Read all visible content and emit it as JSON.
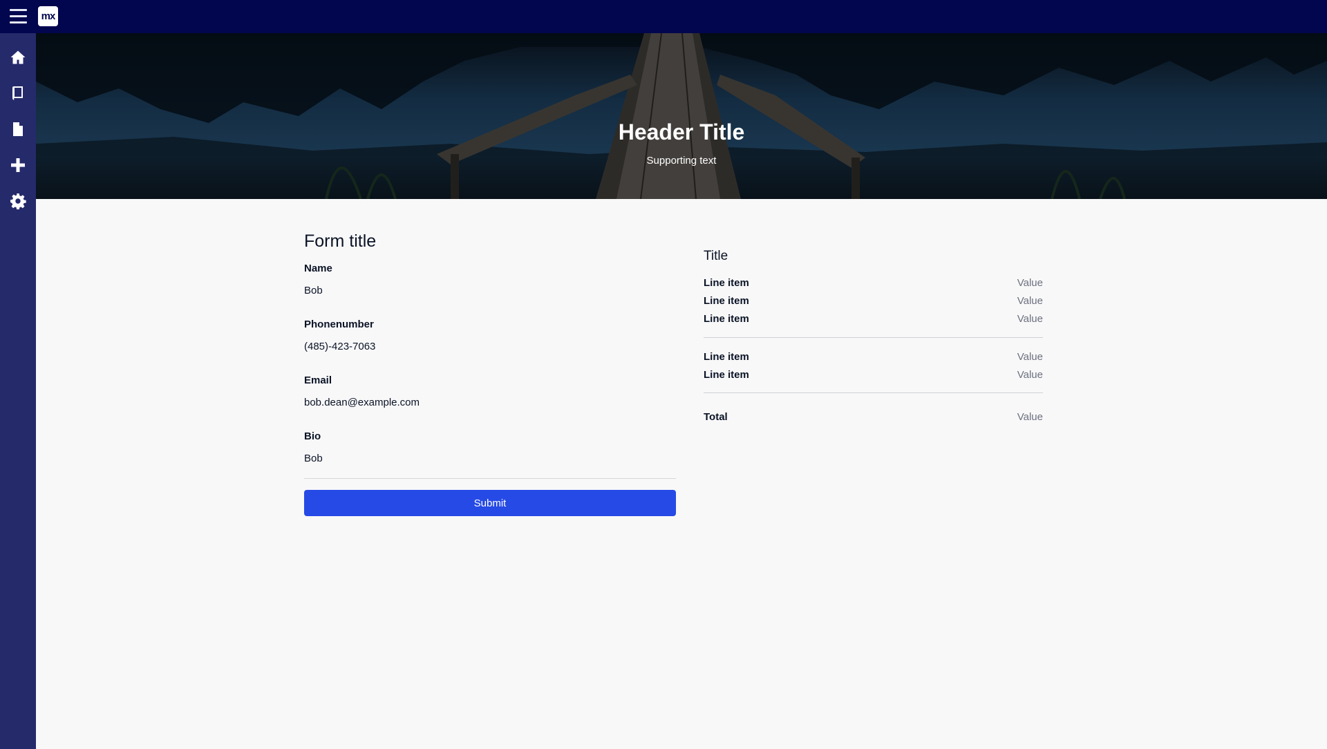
{
  "app": {
    "logo_text": "mx"
  },
  "sidebar": {
    "items": [
      {
        "icon": "home-icon"
      },
      {
        "icon": "book-icon"
      },
      {
        "icon": "document-icon"
      },
      {
        "icon": "plus-icon"
      },
      {
        "icon": "gear-icon"
      }
    ]
  },
  "hero": {
    "title": "Header Title",
    "subtitle": "Supporting text"
  },
  "form": {
    "title": "Form title",
    "fields": [
      {
        "label": "Name",
        "value": "Bob"
      },
      {
        "label": "Phonenumber",
        "value": "(485)-423-7063"
      },
      {
        "label": "Email",
        "value": "bob.dean@example.com"
      },
      {
        "label": "Bio",
        "value": "Bob"
      }
    ],
    "submit_label": "Submit"
  },
  "summary": {
    "title": "Title",
    "group1": [
      {
        "label": "Line item",
        "value": "Value"
      },
      {
        "label": "Line item",
        "value": "Value"
      },
      {
        "label": "Line item",
        "value": "Value"
      }
    ],
    "group2": [
      {
        "label": "Line item",
        "value": "Value"
      },
      {
        "label": "Line item",
        "value": "Value"
      }
    ],
    "total": {
      "label": "Total",
      "value": "Value"
    }
  },
  "colors": {
    "topbar": "#02064f",
    "sidebar": "#252a6b",
    "primary_button": "#264ae5",
    "background": "#f8f8f9"
  }
}
